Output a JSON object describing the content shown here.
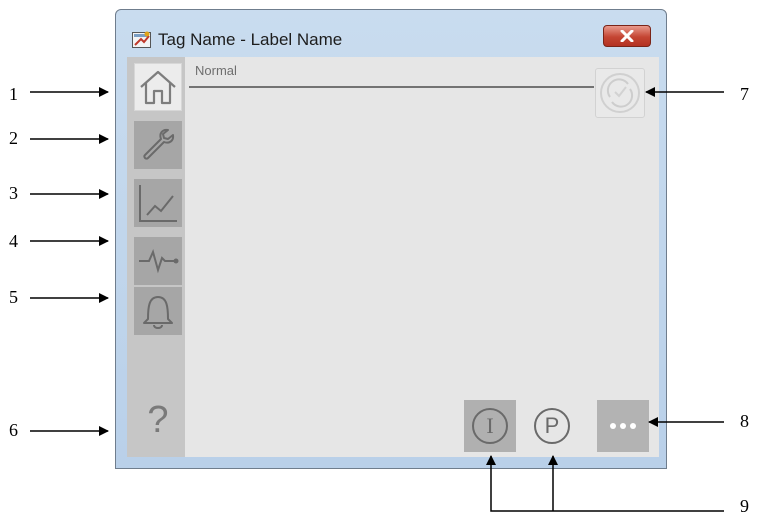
{
  "window": {
    "title": "Tag Name - Label Name",
    "close_label": "×"
  },
  "sidebar": {
    "items": [
      {
        "icon": "home-icon",
        "state": "active"
      },
      {
        "icon": "wrench-icon",
        "state": "inactive"
      },
      {
        "icon": "trend-chart-icon",
        "state": "inactive"
      },
      {
        "icon": "pulse-icon",
        "state": "inactive"
      },
      {
        "icon": "bell-icon",
        "state": "inactive"
      }
    ],
    "help_label": "?"
  },
  "status": {
    "label": "Normal"
  },
  "buttons": {
    "input_label": "I",
    "program_label": "P",
    "more_icon": "ellipsis-icon",
    "refresh_icon": "refresh-icon"
  },
  "callouts": [
    "1",
    "2",
    "3",
    "4",
    "5",
    "6",
    "7",
    "8",
    "9"
  ],
  "colors": {
    "client_background": "#e6e6e6",
    "sidebar_background": "#c6c6c6",
    "button_gray": "#a6a6a6",
    "close_red": "#c44533"
  }
}
